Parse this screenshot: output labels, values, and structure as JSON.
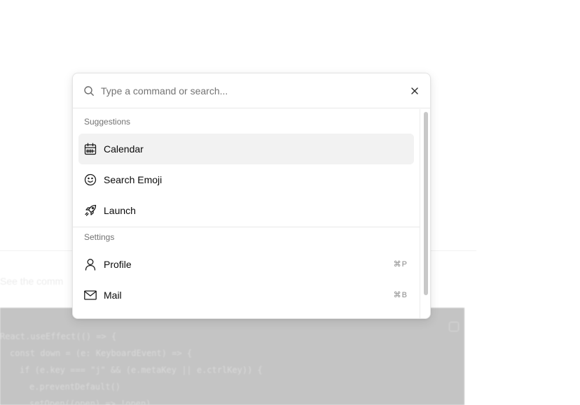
{
  "background": {
    "text": "See the comm",
    "code_lines": [
      "React.useEffect(() => {",
      "  const down = (e: KeyboardEvent) => {",
      "    if (e.key === \"j\" && (e.metaKey || e.ctrlKey)) {",
      "      e.preventDefault()",
      "      setOpen((open) => !open)"
    ]
  },
  "command": {
    "search": {
      "placeholder": "Type a command or search...",
      "value": ""
    },
    "groups": [
      {
        "heading": "Suggestions",
        "items": [
          {
            "label": "Calendar",
            "icon": "calendar-icon",
            "selected": true
          },
          {
            "label": "Search Emoji",
            "icon": "smile-icon",
            "selected": false
          },
          {
            "label": "Launch",
            "icon": "rocket-icon",
            "selected": false
          }
        ]
      },
      {
        "heading": "Settings",
        "items": [
          {
            "label": "Profile",
            "icon": "user-icon",
            "shortcut": "⌘P"
          },
          {
            "label": "Mail",
            "icon": "mail-icon",
            "shortcut": "⌘B"
          }
        ]
      }
    ]
  },
  "colors": {
    "selected_bg": "#f2f2f2",
    "muted_text": "#737373",
    "border": "#e4e4e4"
  }
}
